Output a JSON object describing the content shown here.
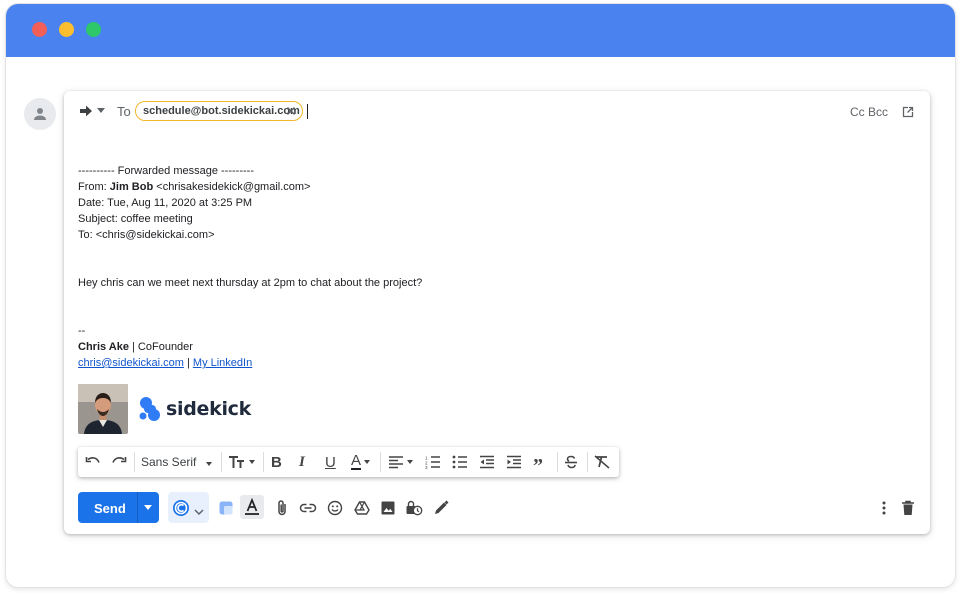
{
  "compose": {
    "to_label": "To",
    "recipient": "schedule@bot.sidekickai.com",
    "cc_bcc": "Cc Bcc"
  },
  "forwarded": {
    "header": "---------- Forwarded message ---------",
    "from_label": "From:",
    "from_name": "Jim Bob",
    "from_email": "<chrisakesidekick@gmail.com>",
    "date": "Date: Tue, Aug 11, 2020 at 3:25 PM",
    "subject": "Subject: coffee meeting",
    "to": "To: <chris@sidekickai.com>"
  },
  "message": "Hey chris can we meet next thursday at 2pm to chat about the project?",
  "signature": {
    "dashes": "--",
    "name": "Chris Ake",
    "title": " | CoFounder",
    "email_link": "chris@sidekickai.com",
    "separator": " | ",
    "linkedin_link": "My LinkedIn",
    "logo_text": "sidekick"
  },
  "toolbar": {
    "font": "Sans Serif"
  },
  "actions": {
    "send_label": "Send"
  },
  "colors": {
    "titlebar": "#4a82f0",
    "send_button": "#1a73e8",
    "chip_border": "#f2b72a",
    "link": "#1155cc"
  },
  "icons": [
    "forward-icon",
    "close-icon",
    "popout-icon",
    "undo-icon",
    "redo-icon",
    "text-size-icon",
    "bold-icon",
    "italic-icon",
    "underline-icon",
    "text-color-icon",
    "align-icon",
    "numbered-list-icon",
    "bulleted-list-icon",
    "indent-less-icon",
    "indent-more-icon",
    "quote-icon",
    "strikethrough-icon",
    "clear-formatting-icon",
    "sidekick-icon",
    "formatting-toggle-icon",
    "attach-icon",
    "link-icon",
    "emoji-icon",
    "drive-icon",
    "photo-icon",
    "confidential-icon",
    "signature-icon",
    "more-options-icon",
    "trash-icon"
  ]
}
